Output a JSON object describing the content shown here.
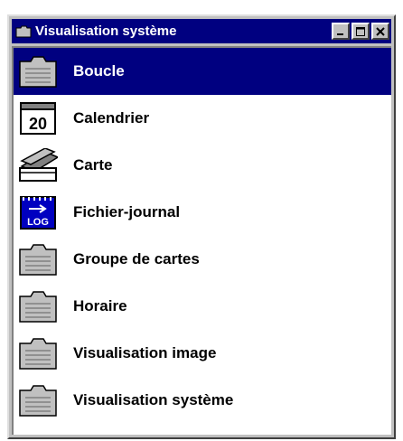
{
  "window": {
    "title": "Visualisation système",
    "buttons": {
      "minimize": "_",
      "maximize": "□",
      "close": "×"
    }
  },
  "items": [
    {
      "label": "Boucle",
      "icon": "folder-icon",
      "selected": true
    },
    {
      "label": "Calendrier",
      "icon": "calendar-icon",
      "icon_text": "20"
    },
    {
      "label": "Carte",
      "icon": "card-stack-icon"
    },
    {
      "label": "Fichier-journal",
      "icon": "log-file-icon",
      "icon_text": "LOG"
    },
    {
      "label": "Groupe de cartes",
      "icon": "folder-icon"
    },
    {
      "label": "Horaire",
      "icon": "folder-icon"
    },
    {
      "label": "Visualisation image",
      "icon": "folder-icon"
    },
    {
      "label": "Visualisation système",
      "icon": "folder-icon"
    }
  ],
  "colors": {
    "titlebar": "#000080",
    "selection": "#000080",
    "face": "#c0c0c0"
  }
}
